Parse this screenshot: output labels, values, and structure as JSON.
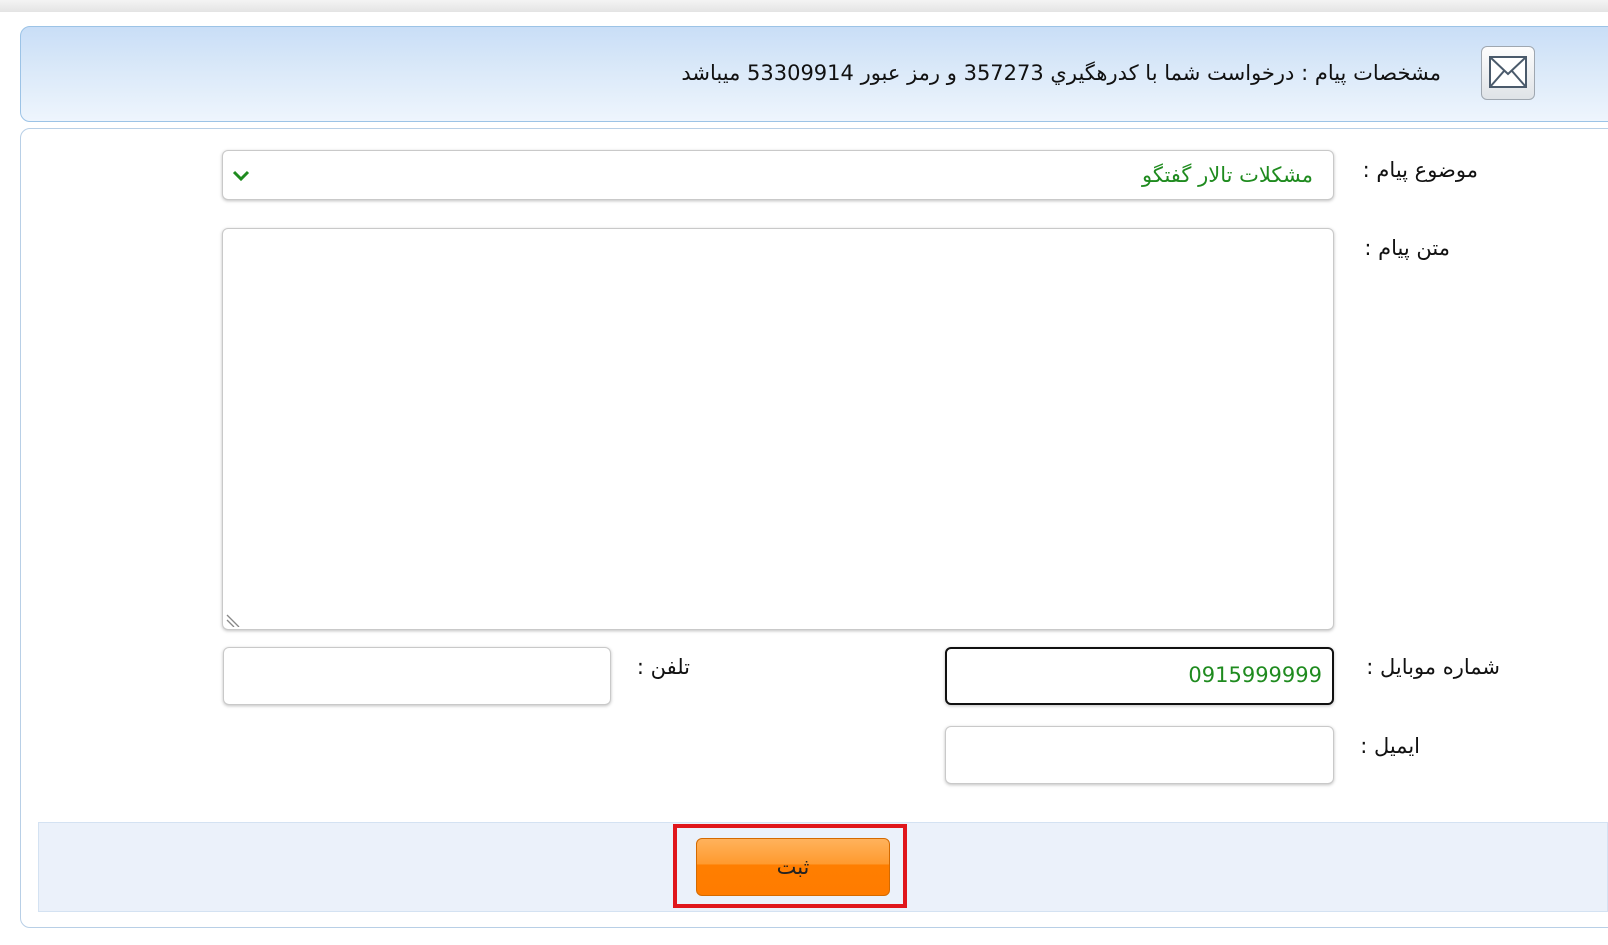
{
  "header": {
    "message": "مشخصات پیام : درخواست شما با کدرهگيري 357273 و رمز عبور 53309914 میباشد",
    "icon": "envelope-icon"
  },
  "form": {
    "subject": {
      "label": "موضوع پیام :",
      "value": "مشکلات تالار گفتگو",
      "icon": "chevron-down-icon"
    },
    "body": {
      "label": "متن پیام :",
      "value": ""
    },
    "mobile": {
      "label": "شماره موبایل :",
      "value": "0915999999"
    },
    "phone": {
      "label": "تلفن :",
      "value": ""
    },
    "email": {
      "label": "ایمیل :",
      "value": ""
    }
  },
  "footer": {
    "submit_label": "ثبت"
  },
  "colors": {
    "value_text": "#1f8b1f",
    "highlight": "#e0161b",
    "button": "#ff8c1a"
  }
}
